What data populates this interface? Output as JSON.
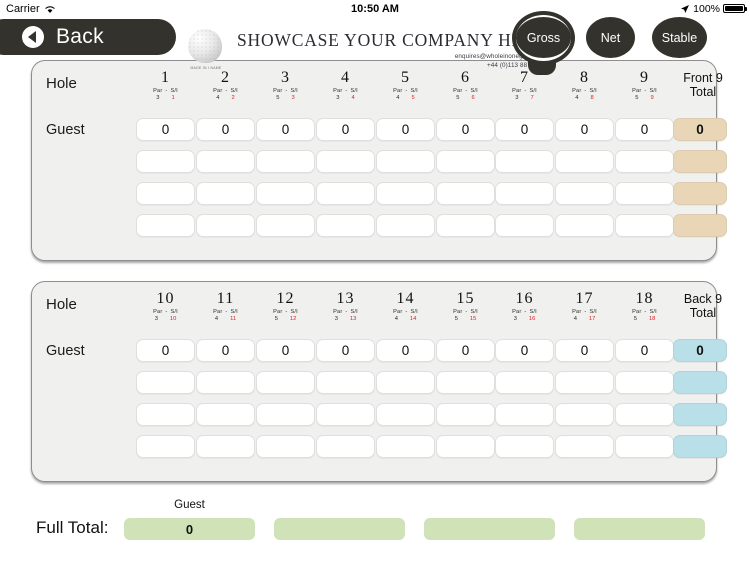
{
  "status_bar": {
    "carrier": "Carrier",
    "wifi_icon": "wifi-icon",
    "time": "10:50 AM",
    "location_icon": "location-arrow-icon",
    "battery_percent": "100%",
    "battery_icon": "battery-full-icon"
  },
  "header": {
    "back_label": "Back",
    "back_icon": "back-arrow-icon",
    "logo_icon": "golf-ball-icon",
    "logo_tag": "MADE IN I NAME",
    "company_title": "SHOWCASE YOUR COMPANY HERE",
    "company_email": "enquires@wholeinonegolf.co.uk",
    "company_phone": "+44 (0)113 8871 567",
    "modes": [
      {
        "label": "Gross",
        "selected": true
      },
      {
        "label": "Net",
        "selected": false
      },
      {
        "label": "Stable",
        "selected": false
      }
    ]
  },
  "front_nine": {
    "hole_header": "Hole",
    "par_si_label_par": "Par",
    "par_si_label_sep": "-",
    "par_si_label_si": "S/I",
    "total_header_line1": "Front 9",
    "total_header_line2": "Total",
    "total_color": "#e8d6b7",
    "holes": [
      {
        "number": "1",
        "par": "3",
        "si": "1"
      },
      {
        "number": "2",
        "par": "4",
        "si": "2"
      },
      {
        "number": "3",
        "par": "5",
        "si": "3"
      },
      {
        "number": "4",
        "par": "3",
        "si": "4"
      },
      {
        "number": "5",
        "par": "4",
        "si": "5"
      },
      {
        "number": "6",
        "par": "5",
        "si": "6"
      },
      {
        "number": "7",
        "par": "3",
        "si": "7"
      },
      {
        "number": "8",
        "par": "4",
        "si": "8"
      },
      {
        "number": "9",
        "par": "5",
        "si": "9"
      }
    ],
    "players": [
      {
        "name": "Guest",
        "scores": [
          "0",
          "0",
          "0",
          "0",
          "0",
          "0",
          "0",
          "0",
          "0"
        ],
        "total": "0"
      },
      {
        "name": "",
        "scores": [
          "",
          "",
          "",
          "",
          "",
          "",
          "",
          "",
          ""
        ],
        "total": ""
      },
      {
        "name": "",
        "scores": [
          "",
          "",
          "",
          "",
          "",
          "",
          "",
          "",
          ""
        ],
        "total": ""
      },
      {
        "name": "",
        "scores": [
          "",
          "",
          "",
          "",
          "",
          "",
          "",
          "",
          ""
        ],
        "total": ""
      }
    ]
  },
  "back_nine": {
    "hole_header": "Hole",
    "par_si_label_par": "Par",
    "par_si_label_sep": "-",
    "par_si_label_si": "S/I",
    "total_header_line1": "Back 9",
    "total_header_line2": "Total",
    "total_color": "#b9dfe9",
    "holes": [
      {
        "number": "10",
        "par": "3",
        "si": "10"
      },
      {
        "number": "11",
        "par": "4",
        "si": "11"
      },
      {
        "number": "12",
        "par": "5",
        "si": "12"
      },
      {
        "number": "13",
        "par": "3",
        "si": "13"
      },
      {
        "number": "14",
        "par": "4",
        "si": "14"
      },
      {
        "number": "15",
        "par": "5",
        "si": "15"
      },
      {
        "number": "16",
        "par": "3",
        "si": "16"
      },
      {
        "number": "17",
        "par": "4",
        "si": "17"
      },
      {
        "number": "18",
        "par": "5",
        "si": "18"
      }
    ],
    "players": [
      {
        "name": "Guest",
        "scores": [
          "0",
          "0",
          "0",
          "0",
          "0",
          "0",
          "0",
          "0",
          "0"
        ],
        "total": "0"
      },
      {
        "name": "",
        "scores": [
          "",
          "",
          "",
          "",
          "",
          "",
          "",
          "",
          ""
        ],
        "total": ""
      },
      {
        "name": "",
        "scores": [
          "",
          "",
          "",
          "",
          "",
          "",
          "",
          "",
          ""
        ],
        "total": ""
      },
      {
        "name": "",
        "scores": [
          "",
          "",
          "",
          "",
          "",
          "",
          "",
          "",
          ""
        ],
        "total": ""
      }
    ]
  },
  "full_total": {
    "label": "Full Total:",
    "box_color": "#cfe2b8",
    "entries": [
      {
        "player": "Guest",
        "value": "0"
      },
      {
        "player": "",
        "value": ""
      },
      {
        "player": "",
        "value": ""
      },
      {
        "player": "",
        "value": ""
      }
    ]
  }
}
